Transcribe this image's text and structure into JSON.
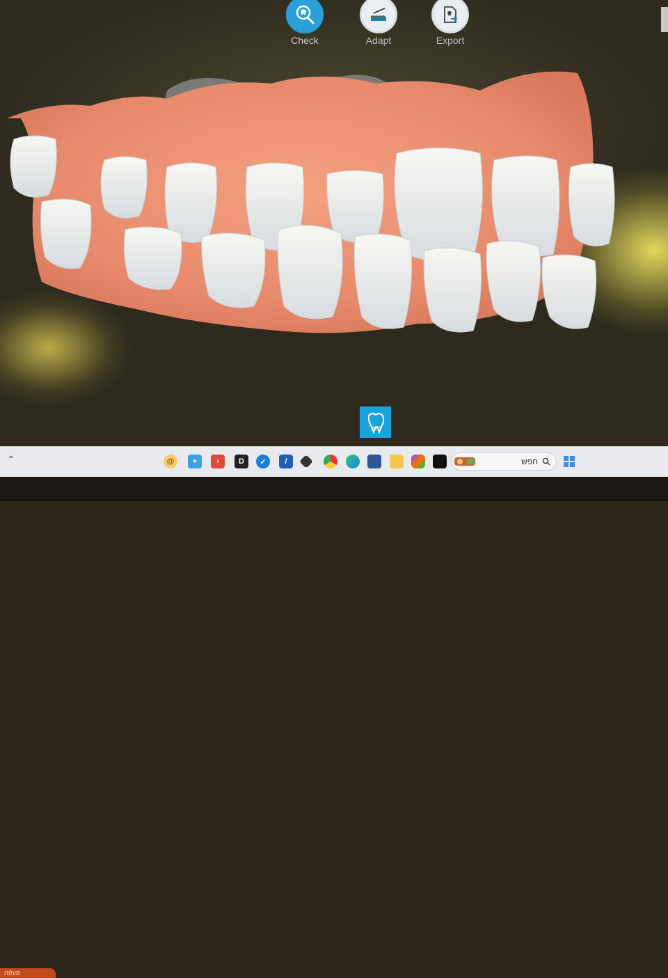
{
  "toolbar": {
    "items": [
      {
        "label": "Check",
        "icon": "tooth-magnifier-icon",
        "active": true
      },
      {
        "label": "Adapt",
        "icon": "tooth-adapt-icon",
        "active": false
      },
      {
        "label": "Export",
        "icon": "export-file-icon",
        "active": false
      }
    ]
  },
  "canvas": {
    "view_button_icon": "tooth-view-icon",
    "accent_color": "#18a3dd"
  },
  "taskbar": {
    "search_text": "חפש",
    "apps": [
      "app-ring-icon",
      "app-blue-icon",
      "app-red-icon",
      "app-d-icon",
      "app-round-blue-icon",
      "app-teal-icon",
      "app-cube-icon",
      "chrome-icon",
      "edge-icon",
      "store-icon",
      "folder-icon",
      "copilot-icon",
      "app-black-icon"
    ]
  },
  "monitor": {
    "brand_text": "ntive"
  }
}
